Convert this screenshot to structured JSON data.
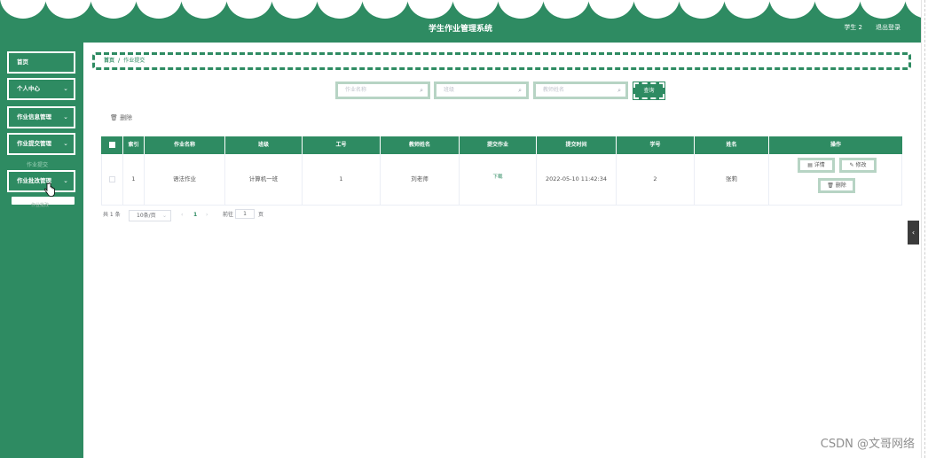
{
  "header": {
    "title": "学生作业管理系统",
    "user": "学生 2",
    "logout": "退出登录"
  },
  "sidebar": {
    "items": [
      {
        "label": "首页"
      },
      {
        "label": "个人中心",
        "chevron": "⌄"
      },
      {
        "label": "作业信息管理",
        "chevron": "⌄"
      },
      {
        "label": "作业提交管理",
        "chevron": "⌄"
      },
      {
        "label": "作业批改管理",
        "chevron": "⌄"
      }
    ],
    "submenu_peek": "作业提交",
    "submenu_bar": "作业批改"
  },
  "breadcrumb": {
    "home": "首页",
    "separator": "/",
    "current": "作业提交"
  },
  "search": {
    "name_placeholder": "作业名称",
    "class_placeholder": "班级",
    "teacher_placeholder": "教师姓名",
    "button": "查询",
    "icon": "search-icon"
  },
  "toolbar": {
    "delete_label": "删除",
    "delete_icon": "trash-icon"
  },
  "table": {
    "columns": [
      "",
      "索引",
      "作业名称",
      "班级",
      "工号",
      "教师姓名",
      "提交作业",
      "提交时间",
      "学号",
      "姓名",
      "操作"
    ],
    "rows": [
      {
        "index": "1",
        "name": "语法作业",
        "class": "计算机一班",
        "job_no": "1",
        "teacher": "刘老师",
        "submit": "下载",
        "time": "2022-05-10 11:42:34",
        "student_no": "2",
        "student_name": "张莉",
        "ops": {
          "detail": "详情",
          "edit": "修改",
          "delete": "删除"
        }
      }
    ]
  },
  "pagination": {
    "total": "共 1 条",
    "page_size": "10条/页",
    "prev": "‹",
    "current": "1",
    "next": "›",
    "goto": "前往",
    "page_value": "1",
    "page_suffix": "页"
  },
  "handle": "‹",
  "watermark": "CSDN @文哥网络",
  "colors": {
    "primary": "#2e8b62",
    "light_border": "#b7d4c4"
  }
}
